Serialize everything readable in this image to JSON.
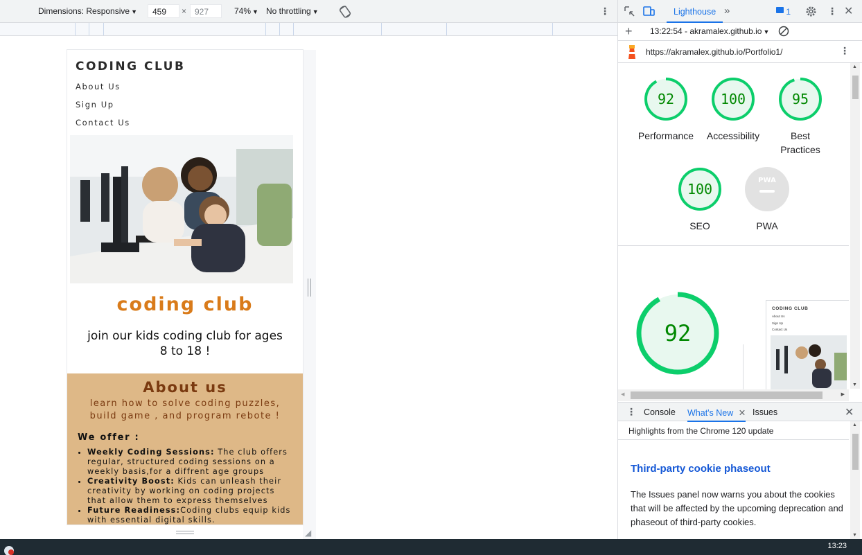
{
  "device_toolbar": {
    "dimensions_label": "Dimensions: Responsive",
    "width_value": "459",
    "times": "×",
    "height_placeholder": "927",
    "zoom": "74%",
    "throttle": "No throttling"
  },
  "mobile_page": {
    "brand": "CODING CLUB",
    "nav": [
      "About Us",
      "Sign Up",
      "Contact Us"
    ],
    "hero_title": "coding  club",
    "hero_subtitle": "join our kids coding club for ages 8 to 18 !",
    "about_title": "About us",
    "about_text": "learn how to solve coding puzzles, build game , and program rebote !",
    "offer_title": "We offer :",
    "offers": [
      {
        "bold": "Weekly Coding Sessions:",
        "text": " The club offers regular, structured coding sessions on a weekly basis,for a diffrent age groups"
      },
      {
        "bold": "Creativity Boost:",
        "text": " Kids can unleash their creativity by working on coding projects that allow them to express themselves"
      },
      {
        "bold": "Future Readiness:",
        "text": "Coding clubs equip kids with essential digital skills."
      }
    ]
  },
  "devtools": {
    "tabs": {
      "active": "Lighthouse",
      "more": "»",
      "issues_count": "1"
    },
    "toolbar": {
      "plus": "+",
      "report": "13:22:54 - akramalex.github.io"
    },
    "url": "https://akramalex.github.io/Portfolio1/",
    "scores": [
      {
        "label": "Performance",
        "value": "92",
        "fraction": 0.92
      },
      {
        "label": "Accessibility",
        "value": "100",
        "fraction": 1.0
      },
      {
        "label": "Best Practices",
        "value": "95",
        "fraction": 0.95
      },
      {
        "label": "SEO",
        "value": "100",
        "fraction": 1.0
      },
      {
        "label": "PWA",
        "value": "PWA",
        "fraction": 0
      }
    ],
    "big_score": "92",
    "thumb": {
      "brand": "CODING CLUB",
      "nav": [
        "About Us",
        "Sign Up",
        "Contact Us"
      ]
    },
    "drawer": {
      "tabs": [
        "Console",
        "What's New",
        "Issues"
      ],
      "active": "What's New",
      "header": "Highlights from the Chrome 120 update",
      "title": "Third-party cookie phaseout",
      "text": "The Issues panel now warns you about the cookies that will be affected by the upcoming deprecation and phaseout of third-party cookies."
    }
  },
  "taskbar": {
    "clock": "13:23"
  },
  "colors": {
    "score_green": "#0cce6b",
    "score_text": "#008800",
    "accent": "#d97b1a",
    "about_bg": "#deb887",
    "link": "#1a73e8"
  }
}
